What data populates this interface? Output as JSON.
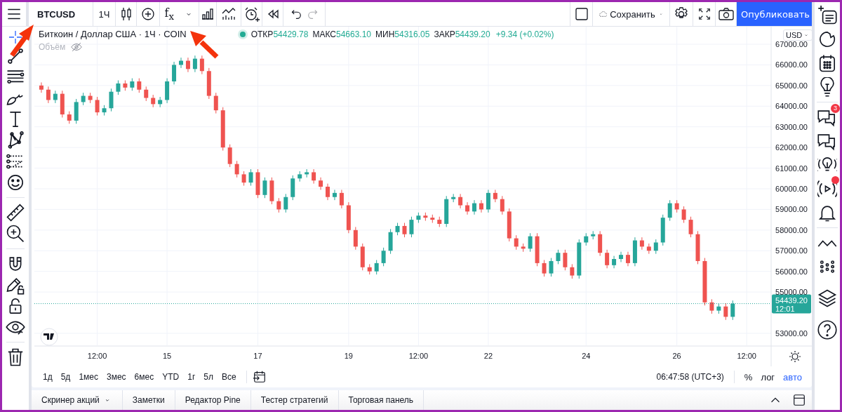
{
  "toolbar": {
    "symbol": "BTCUSD",
    "interval": "1Ч",
    "indicators": "f$_{x}$",
    "redo": {
      "disabled": true
    },
    "save": "Сохранить",
    "publish": "Опубликовать"
  },
  "legend": {
    "title": "Биткоин / Доллар США · 1Ч · COIN",
    "market_open": true,
    "ohlc": [
      {
        "label": "ОТКР",
        "value": "54429.78"
      },
      {
        "label": "МАКС",
        "value": "54663.10"
      },
      {
        "label": "МИН",
        "value": "54316.05"
      },
      {
        "label": "ЗАКР",
        "value": "54439.20"
      }
    ],
    "change": "+9.34 (+0.02%)",
    "volume_label": "Объём"
  },
  "price_axis": {
    "currency": "USD",
    "countdown": "12:01"
  },
  "chart_data": {
    "type": "candlestick",
    "grid": true,
    "ylim": [
      52420,
      67850
    ],
    "yticks": [
      {
        "value": 53000,
        "label": "53000.00"
      },
      {
        "value": 55000,
        "label": "55000.00"
      },
      {
        "value": 56000,
        "label": "56000.00"
      },
      {
        "value": 57000,
        "label": "57000.00"
      },
      {
        "value": 58000,
        "label": "58000.00"
      },
      {
        "value": 59000,
        "label": "59000.00"
      },
      {
        "value": 60000,
        "label": "60000.00"
      },
      {
        "value": 61000,
        "label": "61000.00"
      },
      {
        "value": 62000,
        "label": "62000.00"
      },
      {
        "value": 63000,
        "label": "63000.00"
      },
      {
        "value": 64000,
        "label": "64000.00"
      },
      {
        "value": 65000,
        "label": "65000.00"
      },
      {
        "value": 66000,
        "label": "66000.00"
      },
      {
        "value": 67000,
        "label": "67000.00"
      }
    ],
    "ref_lines": [
      {
        "axis": "y",
        "value": 54439.2,
        "label": "54439.20",
        "color": "#26a69a",
        "line_style": "dotted"
      }
    ],
    "categories": [
      null,
      null,
      null,
      null,
      null,
      null,
      null,
      null,
      "12:00",
      null,
      null,
      null,
      null,
      null,
      null,
      null,
      null,
      null,
      "15",
      null,
      null,
      null,
      null,
      null,
      null,
      null,
      null,
      null,
      null,
      null,
      null,
      "17",
      null,
      null,
      null,
      null,
      null,
      null,
      null,
      null,
      null,
      null,
      null,
      null,
      "19",
      null,
      null,
      null,
      null,
      null,
      null,
      null,
      null,
      null,
      "12:00",
      null,
      null,
      null,
      null,
      null,
      null,
      null,
      null,
      null,
      "22",
      null,
      null,
      null,
      null,
      null,
      null,
      null,
      null,
      null,
      null,
      null,
      null,
      null,
      "24",
      null,
      null,
      null,
      null,
      null,
      null,
      null,
      null,
      null,
      null,
      null,
      null,
      "26",
      null,
      null,
      null,
      null,
      null,
      null,
      null,
      null,
      null,
      "12:00",
      null,
      null,
      null
    ],
    "ohlc": [
      [
        65000,
        65150,
        64650,
        64800
      ],
      [
        64800,
        64950,
        64150,
        64300
      ],
      [
        64300,
        64750,
        64150,
        64600
      ],
      [
        64600,
        64750,
        63450,
        63600
      ],
      [
        63600,
        63750,
        63150,
        63300
      ],
      [
        63300,
        64350,
        63150,
        64200
      ],
      [
        64200,
        64650,
        64050,
        64500
      ],
      [
        64500,
        64650,
        64150,
        64300
      ],
      [
        64300,
        64450,
        63550,
        63700
      ],
      [
        63700,
        64050,
        63550,
        63900
      ],
      [
        63900,
        64850,
        63750,
        64700
      ],
      [
        64700,
        65250,
        64550,
        65100
      ],
      [
        65100,
        65250,
        64750,
        64900
      ],
      [
        64900,
        65350,
        64750,
        65200
      ],
      [
        65200,
        65350,
        64650,
        64800
      ],
      [
        64800,
        64950,
        64250,
        64400
      ],
      [
        64400,
        64550,
        63950,
        64100
      ],
      [
        64100,
        64450,
        63950,
        64300
      ],
      [
        64300,
        65350,
        64150,
        65200
      ],
      [
        65200,
        66150,
        65050,
        66000
      ],
      [
        66000,
        66350,
        65850,
        66200
      ],
      [
        66200,
        66350,
        65650,
        65800
      ],
      [
        65800,
        66450,
        65650,
        66300
      ],
      [
        66300,
        66450,
        65550,
        65700
      ],
      [
        65700,
        65850,
        64350,
        64500
      ],
      [
        64500,
        64650,
        63650,
        63800
      ],
      [
        63800,
        63950,
        61850,
        62000
      ],
      [
        62000,
        62150,
        61050,
        61200
      ],
      [
        61200,
        61350,
        60550,
        60700
      ],
      [
        60700,
        60850,
        60150,
        60300
      ],
      [
        60300,
        60950,
        60150,
        60800
      ],
      [
        60800,
        60950,
        59550,
        59700
      ],
      [
        59700,
        60550,
        59550,
        60400
      ],
      [
        60400,
        60550,
        59250,
        59400
      ],
      [
        59400,
        59550,
        58850,
        59000
      ],
      [
        59000,
        59750,
        58850,
        59600
      ],
      [
        59600,
        60650,
        59450,
        60500
      ],
      [
        60500,
        60850,
        60350,
        60700
      ],
      [
        60700,
        60950,
        60550,
        60800
      ],
      [
        60800,
        60950,
        60250,
        60400
      ],
      [
        60400,
        60550,
        59950,
        60100
      ],
      [
        60100,
        60250,
        59450,
        59600
      ],
      [
        59600,
        59950,
        59450,
        59800
      ],
      [
        59800,
        59950,
        59050,
        59200
      ],
      [
        59200,
        59350,
        57850,
        58000
      ],
      [
        58000,
        58150,
        57050,
        57200
      ],
      [
        57200,
        57350,
        56050,
        56200
      ],
      [
        56200,
        56350,
        55850,
        56000
      ],
      [
        56000,
        56550,
        55850,
        56400
      ],
      [
        56400,
        57150,
        56250,
        57000
      ],
      [
        57000,
        58050,
        56850,
        57900
      ],
      [
        57900,
        58350,
        57750,
        58200
      ],
      [
        58200,
        58350,
        57650,
        57800
      ],
      [
        57800,
        58650,
        57650,
        58500
      ],
      [
        58500,
        58850,
        58350,
        58700
      ],
      [
        58700,
        58850,
        58450,
        58600
      ],
      [
        58600,
        58750,
        58350,
        58500
      ],
      [
        58500,
        58650,
        58150,
        58300
      ],
      [
        58300,
        59650,
        58150,
        59500
      ],
      [
        59500,
        59750,
        59350,
        59600
      ],
      [
        59600,
        59750,
        59050,
        59200
      ],
      [
        59200,
        59350,
        58750,
        58900
      ],
      [
        58900,
        59450,
        58750,
        59300
      ],
      [
        59300,
        59450,
        58850,
        59000
      ],
      [
        59000,
        59950,
        58850,
        59800
      ],
      [
        59800,
        59950,
        59350,
        59500
      ],
      [
        59500,
        59650,
        58750,
        58900
      ],
      [
        58900,
        59050,
        57450,
        57600
      ],
      [
        57600,
        57750,
        57050,
        57200
      ],
      [
        57200,
        57350,
        56950,
        57100
      ],
      [
        57100,
        57850,
        56950,
        57700
      ],
      [
        57700,
        57850,
        56250,
        56400
      ],
      [
        56400,
        56550,
        55750,
        55900
      ],
      [
        55900,
        56650,
        55750,
        56500
      ],
      [
        56500,
        57050,
        56350,
        56900
      ],
      [
        56900,
        57050,
        56050,
        56200
      ],
      [
        56200,
        56350,
        55650,
        55800
      ],
      [
        55800,
        57550,
        55650,
        57400
      ],
      [
        57400,
        57850,
        57250,
        57700
      ],
      [
        57700,
        57950,
        57550,
        57800
      ],
      [
        57800,
        57950,
        56750,
        56900
      ],
      [
        56900,
        57050,
        56150,
        56300
      ],
      [
        56300,
        56750,
        56150,
        56600
      ],
      [
        56600,
        56950,
        56450,
        56800
      ],
      [
        56800,
        56950,
        56250,
        56400
      ],
      [
        56400,
        57650,
        56250,
        57500
      ],
      [
        57500,
        57650,
        57050,
        57200
      ],
      [
        57200,
        57350,
        56850,
        57000
      ],
      [
        57000,
        57550,
        56850,
        57400
      ],
      [
        57400,
        58750,
        57250,
        58600
      ],
      [
        58600,
        59450,
        58450,
        59300
      ],
      [
        59300,
        59450,
        58850,
        59000
      ],
      [
        59000,
        59150,
        58350,
        58500
      ],
      [
        58500,
        58650,
        57650,
        57800
      ],
      [
        57800,
        57950,
        56350,
        56500
      ],
      [
        56500,
        56650,
        54350,
        54500
      ],
      [
        54500,
        54650,
        53950,
        54100
      ],
      [
        54100,
        54450,
        53950,
        54300
      ],
      [
        54300,
        54450,
        53650,
        53800
      ],
      [
        53800,
        54590,
        53650,
        54440
      ],
      null,
      null,
      null,
      null,
      null
    ]
  },
  "ranges": [
    {
      "label": "1д"
    },
    {
      "label": "5д"
    },
    {
      "label": "1мес"
    },
    {
      "label": "3мес"
    },
    {
      "label": "6мес"
    },
    {
      "label": "YTD"
    },
    {
      "label": "1г"
    },
    {
      "label": "5л"
    },
    {
      "label": "Все"
    }
  ],
  "scale": {
    "time": "06:47:58 (UTC+3)",
    "options": [
      {
        "label": "%",
        "selected": false
      },
      {
        "label": "лог",
        "selected": false
      },
      {
        "label": "авто",
        "selected": true
      }
    ]
  },
  "bottom_tabs": [
    {
      "label": "Скринер акций",
      "has_menu": true
    },
    {
      "label": "Заметки",
      "has_menu": false
    },
    {
      "label": "Редактор Pine",
      "has_menu": false
    },
    {
      "label": "Тестер стратегий",
      "has_menu": false
    },
    {
      "label": "Торговая панель",
      "has_menu": false
    }
  ],
  "sidebar": {
    "chat_badge": "3",
    "stream_live": true
  }
}
